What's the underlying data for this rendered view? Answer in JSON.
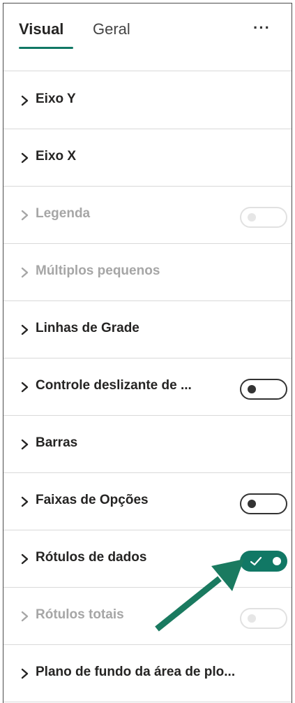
{
  "tabs": {
    "visual_label": "Visual",
    "geral_label": "Geral",
    "more_label": "···"
  },
  "sections": [
    {
      "label": "Eixo Y",
      "disabled": false,
      "toggle": null
    },
    {
      "label": "Eixo X",
      "disabled": false,
      "toggle": null
    },
    {
      "label": "Legenda",
      "disabled": true,
      "toggle": "disabled-off"
    },
    {
      "label": "Múltiplos pequenos",
      "disabled": true,
      "toggle": null
    },
    {
      "label": "Linhas de Grade",
      "disabled": false,
      "toggle": null
    },
    {
      "label": "Controle deslizante de ...",
      "disabled": false,
      "toggle": "off"
    },
    {
      "label": "Barras",
      "disabled": false,
      "toggle": null
    },
    {
      "label": "Faixas de Opções",
      "disabled": false,
      "toggle": "off"
    },
    {
      "label": "Rótulos de dados",
      "disabled": false,
      "toggle": "on"
    },
    {
      "label": "Rótulos totais",
      "disabled": true,
      "toggle": "disabled-off"
    },
    {
      "label": "Plano de fundo da área de plo...",
      "disabled": false,
      "toggle": null
    }
  ],
  "colors": {
    "accent": "#117865",
    "arrow": "#1a7a60",
    "disabled_text": "#a6a6a6"
  },
  "icons": {
    "chevron": "chevron-right-icon",
    "more": "more-options-icon",
    "check": "checkmark-icon"
  }
}
